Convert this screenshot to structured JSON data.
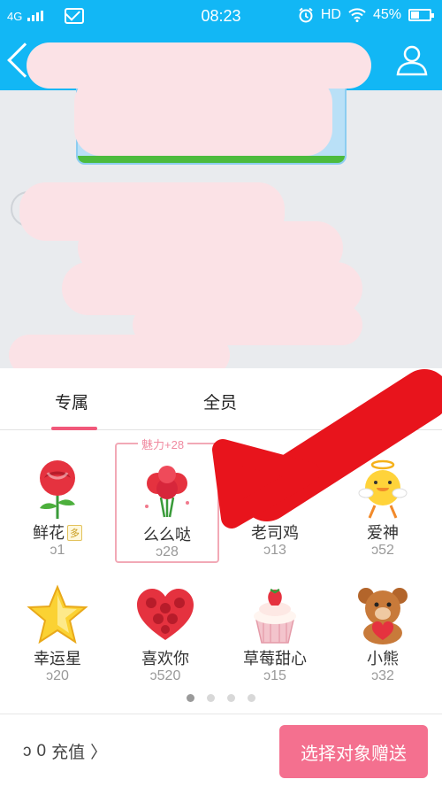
{
  "status_bar": {
    "network": "4G",
    "time": "08:23",
    "hd_label": "HD",
    "battery": "45%",
    "battery_level": 0.45
  },
  "tabs": [
    {
      "label": "专属",
      "active": true
    },
    {
      "label": "全员",
      "active": false
    }
  ],
  "gifts": [
    {
      "name": "鲜花",
      "tag": "多",
      "price": "1",
      "icon": "rose-icon"
    },
    {
      "name": "么么哒",
      "price": "28",
      "icon": "rose-bouquet-icon",
      "selected": true,
      "charm": "魅力+28"
    },
    {
      "name": "老司鸡",
      "price": "13",
      "icon": "chicken-icon"
    },
    {
      "name": "爱神",
      "price": "52",
      "icon": "cupid-icon"
    },
    {
      "name": "幸运星",
      "price": "20",
      "icon": "star-icon"
    },
    {
      "name": "喜欢你",
      "price": "520",
      "icon": "heart-roses-icon"
    },
    {
      "name": "草莓甜心",
      "price": "15",
      "icon": "cupcake-icon"
    },
    {
      "name": "小熊",
      "price": "32",
      "icon": "bear-icon"
    }
  ],
  "pagination": {
    "pages": 4,
    "current": 1
  },
  "footer": {
    "balance": "0",
    "recharge_label": "充值",
    "send_label": "选择对象赠送"
  },
  "colors": {
    "primary": "#12b7f5",
    "accent": "#f4708f",
    "annotation_arrow": "#e8141c"
  }
}
